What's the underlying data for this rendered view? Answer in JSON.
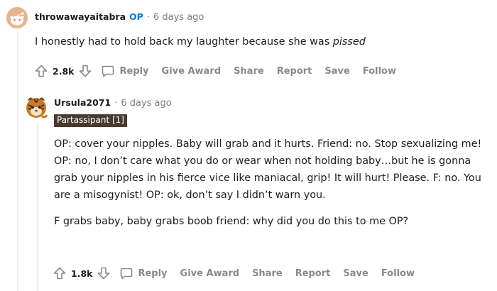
{
  "comment1": {
    "username": "throwawayaitabra",
    "op_tag": "OP",
    "separator": "·",
    "time": "6 days ago",
    "body_prefix": "I honestly had to hold back my laughter because she was ",
    "body_italic": "pissed",
    "votes": "2.8k",
    "actions": {
      "reply": "Reply",
      "give_award": "Give Award",
      "share": "Share",
      "report": "Report",
      "save": "Save",
      "follow": "Follow"
    }
  },
  "comment2": {
    "username": "Ursula2071",
    "separator": "·",
    "time": "6 days ago",
    "flair": "Partassipant [1]",
    "paragraph1": "OP: cover your nipples. Baby will grab and it hurts. Friend: no. Stop sexualizing me! OP: no, I don’t care what you do or wear when not holding baby…but he is gonna grab your nipples in his fierce vice like maniacal, grip! It will hurt! Please. F: no. You are a misogynist! OP: ok, don’t say I didn’t warn you.",
    "paragraph2": "F grabs baby, baby grabs boob friend: why did you do this to me OP?",
    "votes": "1.8k",
    "actions": {
      "reply": "Reply",
      "give_award": "Give Award",
      "share": "Share",
      "report": "Report",
      "save": "Save",
      "follow": "Follow"
    }
  },
  "colors": {
    "op_blue": "#0079d3",
    "meta_gray": "#7c7c7c",
    "action_gray": "#878a8c",
    "flair_bg": "#4a3a2e",
    "thread_line": "#edeff1"
  }
}
